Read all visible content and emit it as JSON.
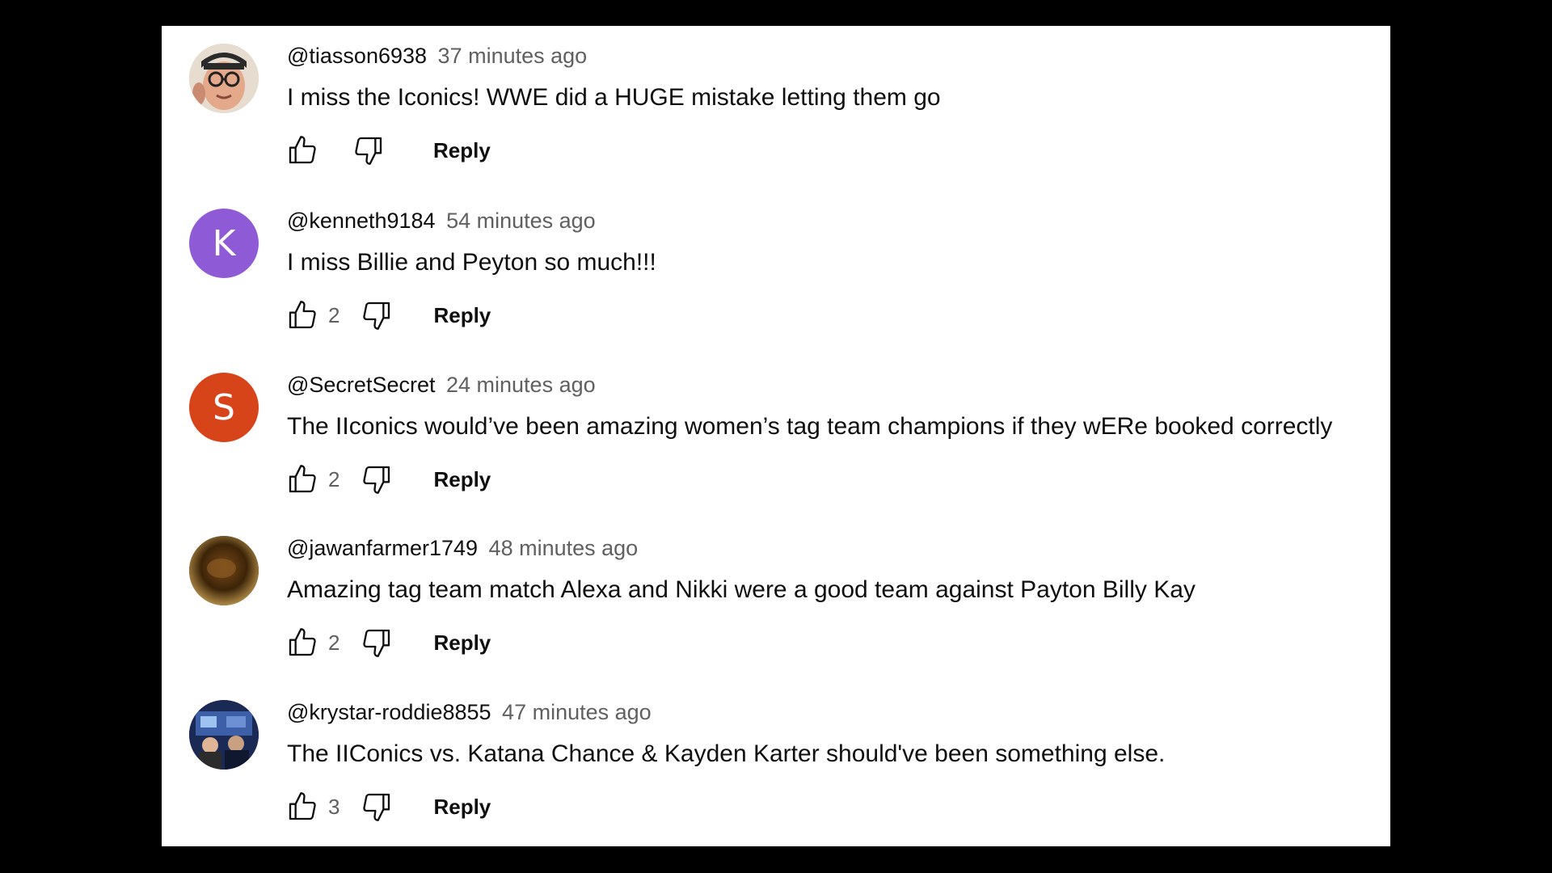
{
  "comments": [
    {
      "author": "@tiasson6938",
      "time": "37 minutes ago",
      "text": "I miss the Iconics! WWE did a HUGE mistake letting them go",
      "likes": "",
      "reply_label": "Reply",
      "avatar": {
        "type": "photo",
        "icon": "person-with-glasses-photo"
      }
    },
    {
      "author": "@kenneth9184",
      "time": "54 minutes ago",
      "text": "I miss Billie and Peyton so much!!!",
      "likes": "2",
      "reply_label": "Reply",
      "avatar": {
        "type": "letter",
        "letter": "K",
        "color": "#8e5ad6"
      }
    },
    {
      "author": "@SecretSecret",
      "time": "24 minutes ago",
      "text": "The IIconics would’ve been amazing women’s tag team champions if they wERe booked correctly",
      "likes": "2",
      "reply_label": "Reply",
      "avatar": {
        "type": "letter",
        "letter": "S",
        "color": "#d74419"
      }
    },
    {
      "author": "@jawanfarmer1749",
      "time": "48 minutes ago",
      "text": "Amazing tag team match Alexa and Nikki were a good team against Payton Billy Kay",
      "likes": "2",
      "reply_label": "Reply",
      "avatar": {
        "type": "photo",
        "icon": "dark-brown-photo"
      }
    },
    {
      "author": "@krystar-roddie8855",
      "time": "47 minutes ago",
      "text": "The IIConics vs. Katana Chance & Kayden Karter should've been something else.",
      "likes": "3",
      "reply_label": "Reply",
      "avatar": {
        "type": "photo",
        "icon": "group-photo"
      }
    }
  ],
  "icons": {
    "like": "thumbs-up-icon",
    "dislike": "thumbs-down-icon"
  },
  "colors": {
    "background": "#000000",
    "panel": "#ffffff",
    "text": "#0f0f0f",
    "secondary": "#606060"
  }
}
